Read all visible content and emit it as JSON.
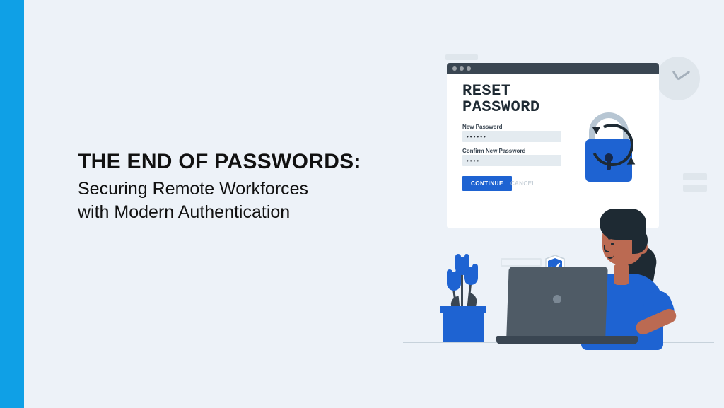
{
  "accent_color": "#0fa0e6",
  "headline": {
    "title": "THE END OF PASSWORDS:",
    "subtitle_line1": "Securing Remote Workforces",
    "subtitle_line2": "with Modern Authentication"
  },
  "illustration": {
    "window": {
      "title_line1": "RESET",
      "title_line2": "PASSWORD",
      "field1_label": "New Password",
      "field1_value": "••••••",
      "field2_label": "Confirm New Password",
      "field2_value": "••••",
      "continue_label": "CONTINUE",
      "cancel_label": "CANCEL"
    },
    "icons": {
      "lock": "lock-icon",
      "refresh": "refresh-icon",
      "shield": "shield-check-icon",
      "clock": "clock-icon",
      "plant": "plant-icon"
    }
  }
}
